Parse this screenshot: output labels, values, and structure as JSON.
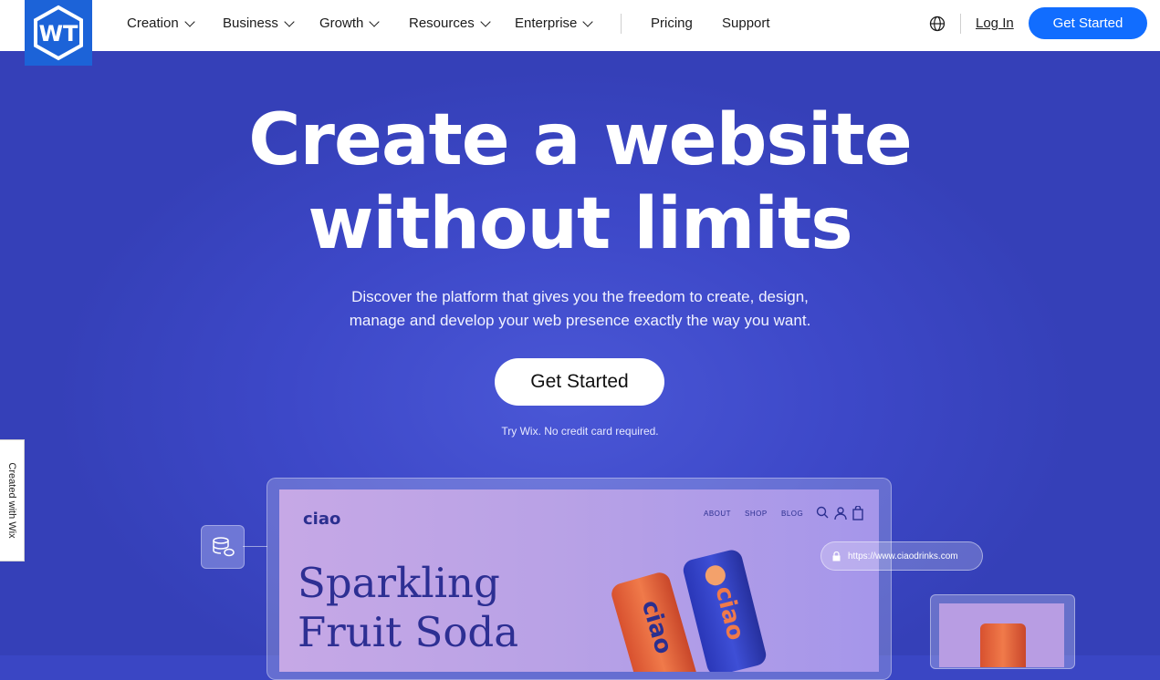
{
  "brand": {
    "logo_text": "WT"
  },
  "nav": {
    "items": [
      {
        "label": "Creation"
      },
      {
        "label": "Business"
      },
      {
        "label": "Growth"
      },
      {
        "label": "Resources"
      },
      {
        "label": "Enterprise"
      }
    ],
    "pricing": "Pricing",
    "support": "Support",
    "login": "Log In",
    "cta": "Get Started"
  },
  "hero": {
    "headline_line1": "Create a website",
    "headline_line2": "without limits",
    "subtitle_line1": "Discover the platform that gives you the freedom to create, design,",
    "subtitle_line2": "manage and develop your web presence exactly the way you want.",
    "cta": "Get Started",
    "note": "Try Wix. No credit card required."
  },
  "side_tab": {
    "label": "Created with Wix"
  },
  "preview": {
    "site_logo": "ciao",
    "site_nav": [
      "ABOUT",
      "SHOP",
      "BLOG"
    ],
    "headline_line1": "Sparkling",
    "headline_line2": "Fruit Soda",
    "url": "https://www.ciaodrinks.com",
    "can_label": "ciao"
  },
  "colors": {
    "accent": "#116dff",
    "hero_bg": "#3d48c8",
    "logo_bg": "#1c63d8"
  }
}
